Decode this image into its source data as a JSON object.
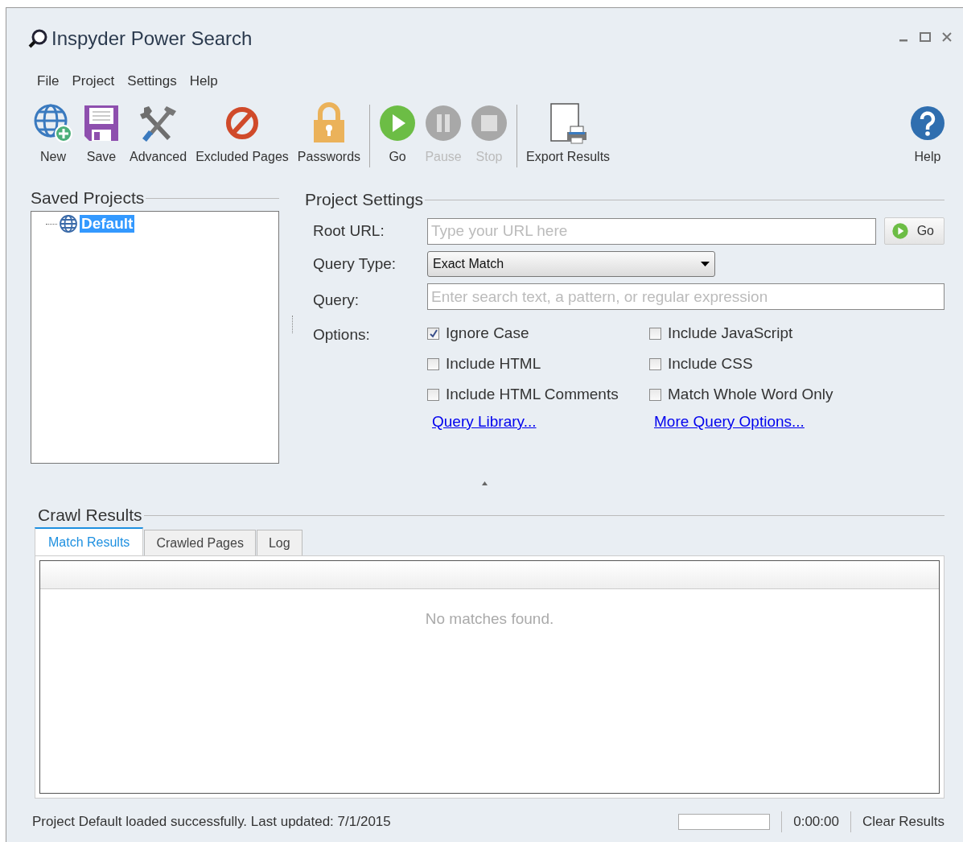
{
  "window": {
    "title": "Inspyder Power Search"
  },
  "menu": [
    "File",
    "Project",
    "Settings",
    "Help"
  ],
  "toolbar": {
    "groups": [
      [
        {
          "kind": "new",
          "label": "New",
          "disabled": false
        },
        {
          "kind": "save",
          "label": "Save",
          "disabled": false
        },
        {
          "kind": "advanced",
          "label": "Advanced",
          "disabled": false
        },
        {
          "kind": "excluded",
          "label": "Excluded Pages",
          "disabled": false
        },
        {
          "kind": "passwords",
          "label": "Passwords",
          "disabled": false
        }
      ],
      [
        {
          "kind": "go",
          "label": "Go",
          "disabled": false
        },
        {
          "kind": "pause",
          "label": "Pause",
          "disabled": true
        },
        {
          "kind": "stop",
          "label": "Stop",
          "disabled": true
        }
      ],
      [
        {
          "kind": "export",
          "label": "Export Results",
          "disabled": false
        }
      ]
    ],
    "help": {
      "kind": "help",
      "label": "Help",
      "disabled": false
    }
  },
  "saved_projects": {
    "heading": "Saved Projects",
    "items": [
      {
        "label": "Default",
        "selected": true
      }
    ]
  },
  "project_settings": {
    "heading": "Project Settings",
    "root_url": {
      "label": "Root URL:",
      "placeholder": "Type your URL here",
      "button": "Go"
    },
    "query_type": {
      "label": "Query Type:",
      "value": "Exact Match"
    },
    "query": {
      "label": "Query:",
      "placeholder": "Enter search text, a pattern, or regular expression"
    },
    "options": {
      "label": "Options:",
      "items": [
        {
          "label": "Ignore Case",
          "checked": true
        },
        {
          "label": "Include JavaScript",
          "checked": false
        },
        {
          "label": "Include HTML",
          "checked": false
        },
        {
          "label": "Include CSS",
          "checked": false
        },
        {
          "label": "Include HTML Comments",
          "checked": false
        },
        {
          "label": "Match Whole Word Only",
          "checked": false
        }
      ]
    },
    "links": [
      "Query Library...",
      "More Query Options..."
    ]
  },
  "crawl_results": {
    "heading": "Crawl Results",
    "tabs": [
      {
        "label": "Match Results",
        "selected": true
      },
      {
        "label": "Crawled Pages",
        "selected": false
      },
      {
        "label": "Log",
        "selected": false
      }
    ],
    "empty_message": "No matches found."
  },
  "status_bar": {
    "message": "Project Default loaded successfully. Last updated: 7/1/2015",
    "progress": {
      "level": 0
    },
    "elapsed": "0:00:00",
    "clear_button": "Clear Results"
  }
}
